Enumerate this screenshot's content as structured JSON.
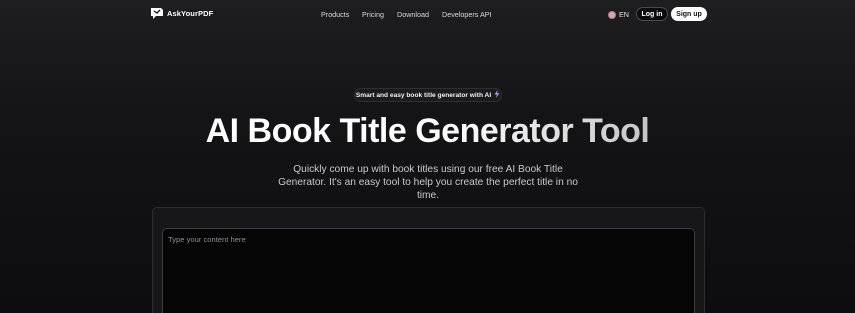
{
  "brand": {
    "name": "AskYourPDF",
    "logo_icon": "askyourpdf-logo-icon"
  },
  "nav": {
    "links": [
      "Products",
      "Pricing",
      "Download",
      "Developers API"
    ],
    "language": "EN",
    "language_icon": "globe-icon",
    "login_label": "Log in",
    "signup_label": "Sign up"
  },
  "hero": {
    "badge_text": "Smart and easy book title generator with AI",
    "badge_icon": "lightning-bolt-icon",
    "title": "AI Book Title Generator Tool",
    "subtitle": "Quickly come up with book titles using our free AI Book Title Generator. It's an easy tool to help you create the perfect title in no time."
  },
  "input": {
    "placeholder": "Type your content here",
    "value": ""
  },
  "colors": {
    "background": "#141416",
    "accent_bolt": "#8da2ff",
    "signup_bg": "#ffffff"
  }
}
